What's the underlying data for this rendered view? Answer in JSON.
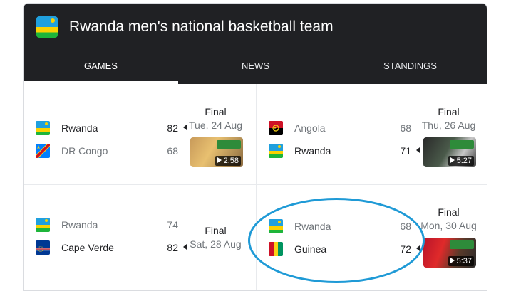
{
  "header": {
    "title": "Rwanda men's national basketball team",
    "flag_icon": "rwanda-flag-icon"
  },
  "tabs": [
    {
      "label": "GAMES",
      "active": true
    },
    {
      "label": "NEWS",
      "active": false
    },
    {
      "label": "STANDINGS",
      "active": false
    }
  ],
  "games": [
    {
      "status": "Final",
      "date": "Tue, 24 Aug",
      "teams": [
        {
          "name": "Rwanda",
          "score": "82",
          "winner": true,
          "flag": "rwanda-flag-icon"
        },
        {
          "name": "DR Congo",
          "score": "68",
          "winner": false,
          "flag": "dr-congo-flag-icon"
        }
      ],
      "video_duration": "2:58"
    },
    {
      "status": "Final",
      "date": "Thu, 26 Aug",
      "teams": [
        {
          "name": "Angola",
          "score": "68",
          "winner": false,
          "flag": "angola-flag-icon"
        },
        {
          "name": "Rwanda",
          "score": "71",
          "winner": true,
          "flag": "rwanda-flag-icon"
        }
      ],
      "video_duration": "5:27"
    },
    {
      "status": "Final",
      "date": "Sat, 28 Aug",
      "teams": [
        {
          "name": "Rwanda",
          "score": "74",
          "winner": false,
          "flag": "rwanda-flag-icon"
        },
        {
          "name": "Cape Verde",
          "score": "82",
          "winner": true,
          "flag": "cape-verde-flag-icon"
        }
      ]
    },
    {
      "status": "Final",
      "date": "Mon, 30 Aug",
      "teams": [
        {
          "name": "Rwanda",
          "score": "68",
          "winner": false,
          "flag": "rwanda-flag-icon"
        },
        {
          "name": "Guinea",
          "score": "72",
          "winner": true,
          "flag": "guinea-flag-icon"
        }
      ],
      "video_duration": "5:37"
    }
  ],
  "colors": {
    "header_bg": "#202124",
    "highlight_ring": "#1f9ad6",
    "winner_text": "#202124",
    "loser_text": "#70757a"
  }
}
